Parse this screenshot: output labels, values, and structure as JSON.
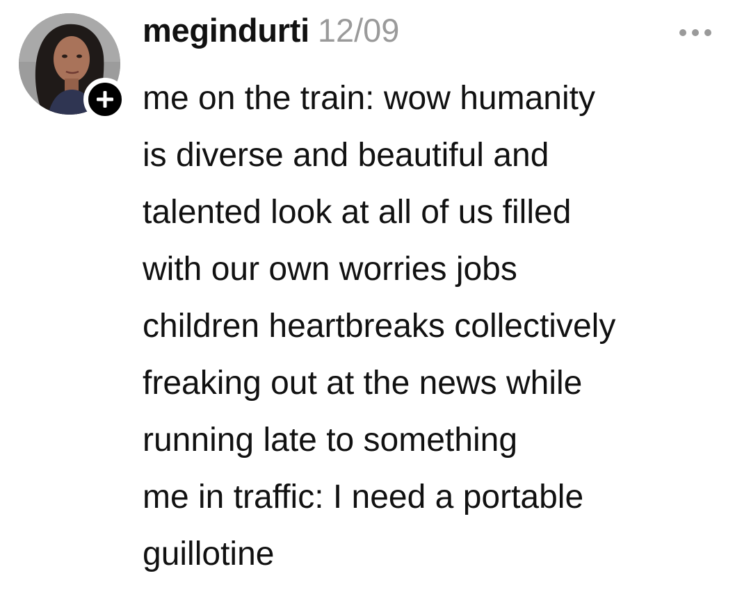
{
  "post": {
    "username": "megindurti",
    "timestamp": "12/09",
    "avatar_icon": "profile-photo",
    "follow_icon": "plus-icon",
    "more_icon": "more-horizontal-icon",
    "text_lines": [
      "me on the train: wow humanity",
      "is diverse and beautiful and",
      "talented look at all of us filled",
      "with our own worries jobs",
      "children heartbreaks collectively",
      "freaking out at the news while",
      "running late to something",
      "me in traffic: I need a portable",
      "guillotine"
    ]
  },
  "colors": {
    "text": "#111111",
    "timestamp": "#9a9a9a",
    "background": "#ffffff",
    "badge": "#000000"
  }
}
